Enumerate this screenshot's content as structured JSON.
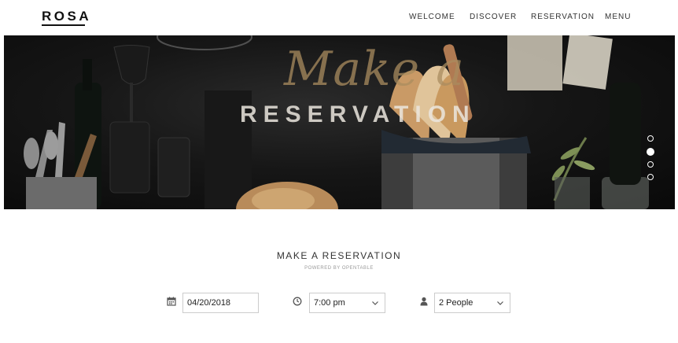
{
  "nav": {
    "logo": "ROSA",
    "items": [
      {
        "label": "WELCOME"
      },
      {
        "label": "DISCOVER"
      },
      {
        "label": "RESERVATION"
      },
      {
        "label": "MENU"
      }
    ]
  },
  "hero": {
    "script_text": "Make a",
    "title": "RESERVATION",
    "slide_count": 4,
    "active_slide": 2
  },
  "reservation": {
    "title": "MAKE A RESERVATION",
    "subtitle": "POWERED BY OPENTABLE",
    "date": {
      "value": "04/20/2018",
      "icon": "calendar-icon"
    },
    "time": {
      "value": "7:00 pm",
      "icon": "clock-icon"
    },
    "party": {
      "value": "2 People",
      "icon": "user-icon"
    }
  },
  "colors": {
    "accent_script": "#aa8c5f",
    "text_dark": "#333333",
    "border": "#cccccc"
  }
}
